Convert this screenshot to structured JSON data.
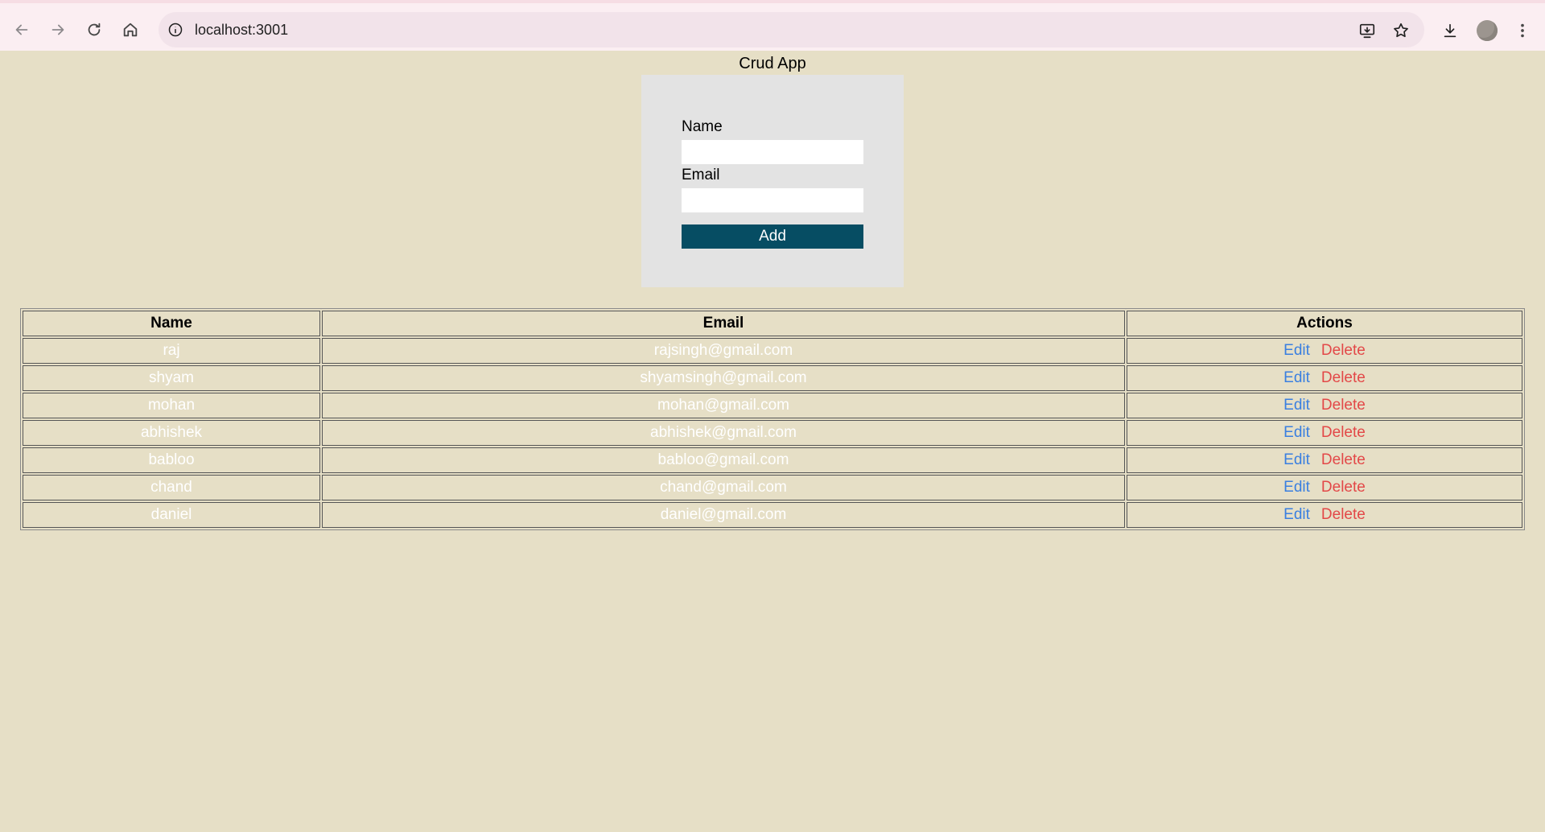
{
  "browser": {
    "url": "localhost:3001",
    "icons": {
      "back": "arrow-left-icon",
      "forward": "arrow-right-icon",
      "reload": "reload-icon",
      "home": "home-icon",
      "site_info": "info-icon",
      "install": "install-app-icon",
      "bookmark": "star-icon",
      "downloads": "download-icon",
      "menu": "kebab-menu-icon"
    }
  },
  "app": {
    "title": "Crud App"
  },
  "form": {
    "name_label": "Name",
    "name_value": "",
    "email_label": "Email",
    "email_value": "",
    "add_label": "Add"
  },
  "table": {
    "headers": {
      "name": "Name",
      "email": "Email",
      "actions": "Actions"
    },
    "edit_label": "Edit",
    "delete_label": "Delete",
    "rows": [
      {
        "name": "raj",
        "email": "rajsingh@gmail.com"
      },
      {
        "name": "shyam",
        "email": "shyamsingh@gmail.com"
      },
      {
        "name": "mohan",
        "email": "mohan@gmail.com"
      },
      {
        "name": "abhishek",
        "email": "abhishek@gmail.com"
      },
      {
        "name": "babloo",
        "email": "babloo@gmail.com"
      },
      {
        "name": "chand",
        "email": "chand@gmail.com"
      },
      {
        "name": "daniel",
        "email": "daniel@gmail.com"
      }
    ]
  },
  "colors": {
    "page_background": "#e6dfc6",
    "form_background": "#e3e3e3",
    "add_button": "#064d63",
    "edit_link": "#3a7fe0",
    "delete_link": "#e34848"
  }
}
